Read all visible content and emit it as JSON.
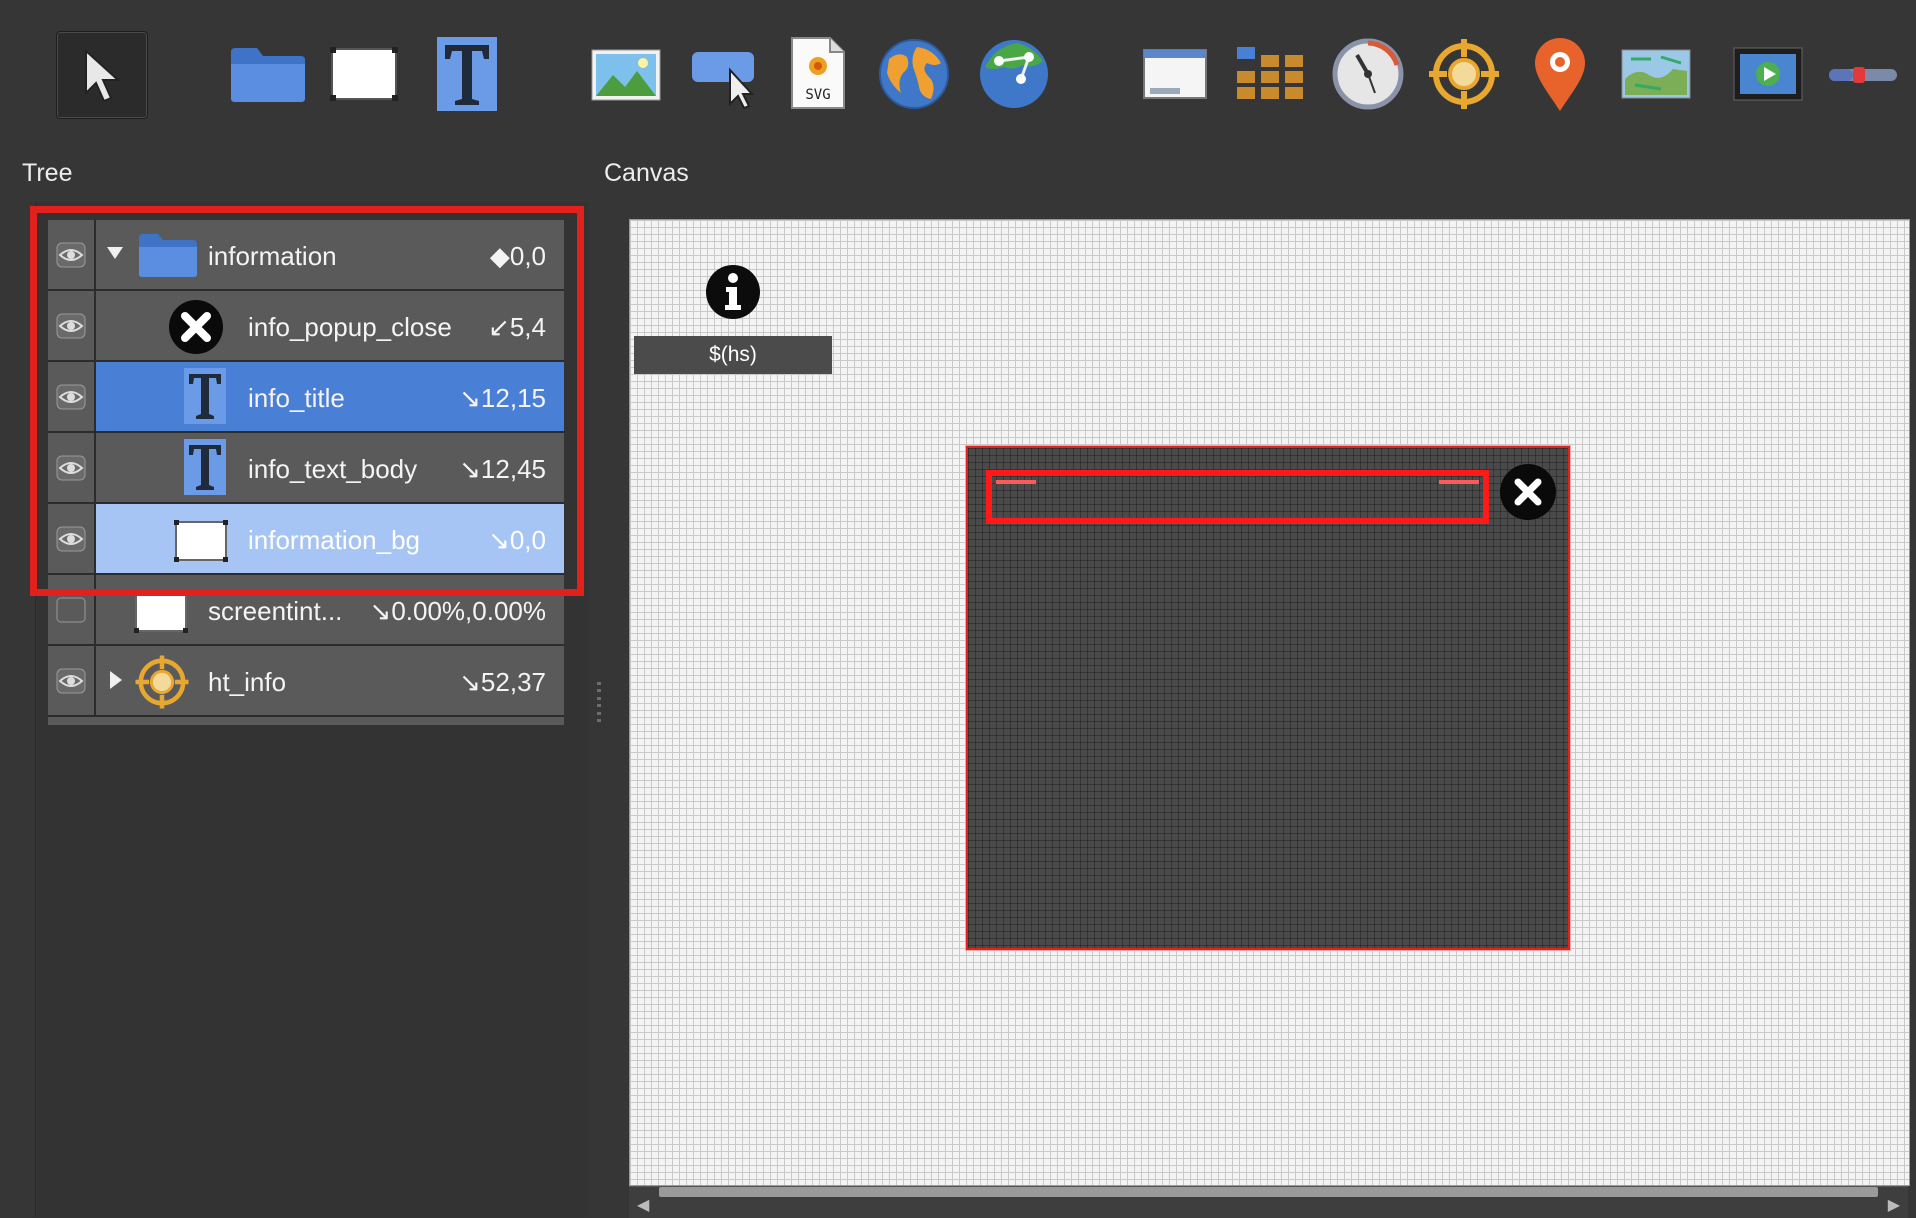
{
  "panels": {
    "tree_title": "Tree",
    "canvas_title": "Canvas"
  },
  "toolbar": {
    "tools": [
      {
        "name": "pointer-tool",
        "icon": "arrow-pointer-icon"
      },
      {
        "name": "container-tool",
        "icon": "folder-icon"
      },
      {
        "name": "rectangle-tool",
        "icon": "rectangle-icon"
      },
      {
        "name": "text-tool",
        "icon": "text-t-icon"
      },
      {
        "name": "image-tool",
        "icon": "image-landscape-icon"
      },
      {
        "name": "button-tool",
        "icon": "button-cursor-icon"
      },
      {
        "name": "svg-tool",
        "icon": "svg-file-icon",
        "label": "SVG"
      },
      {
        "name": "map-tool",
        "icon": "globe-icon"
      },
      {
        "name": "node-map-tool",
        "icon": "network-globe-icon"
      },
      {
        "name": "window-tool",
        "icon": "window-icon"
      },
      {
        "name": "grid-tool",
        "icon": "grid-icon"
      },
      {
        "name": "compass-tool",
        "icon": "compass-icon"
      },
      {
        "name": "hotspot-tool",
        "icon": "crosshair-icon"
      },
      {
        "name": "map-pin-tool",
        "icon": "map-pin-icon"
      },
      {
        "name": "floorplan-tool",
        "icon": "floorplan-icon"
      },
      {
        "name": "video-tool",
        "icon": "video-player-icon"
      },
      {
        "name": "slider-tool",
        "icon": "slider-icon"
      }
    ]
  },
  "tree": {
    "rows": [
      {
        "label": "information",
        "coord": "◆0,0",
        "visible": true,
        "expanded": true,
        "icon": "folder-icon",
        "selection": "none"
      },
      {
        "label": "info_popup_close",
        "coord": "↙5,4",
        "visible": true,
        "icon": "close-circle-icon",
        "selection": "none"
      },
      {
        "label": "info_title",
        "coord": "↘12,15",
        "visible": true,
        "icon": "text-t-icon",
        "selection": "primary"
      },
      {
        "label": "info_text_body",
        "coord": "↘12,45",
        "visible": true,
        "icon": "text-t-icon",
        "selection": "none"
      },
      {
        "label": "information_bg",
        "coord": "↘0,0",
        "visible": true,
        "icon": "rectangle-icon",
        "selection": "secondary"
      },
      {
        "label": "screentint...",
        "coord": "↘0.00%,0.00%",
        "visible": false,
        "icon": "rectangle-icon",
        "selection": "none"
      },
      {
        "label": "ht_info",
        "coord": "↘52,37",
        "visible": true,
        "expanded": false,
        "icon": "crosshair-icon",
        "selection": "none"
      }
    ]
  },
  "canvas": {
    "hotspot_label": "$(hs)"
  },
  "colors": {
    "background": "#363636",
    "selection_primary": "#4a7fd6",
    "selection_secondary": "#a6c5f5",
    "highlight_red": "#e3211c"
  }
}
